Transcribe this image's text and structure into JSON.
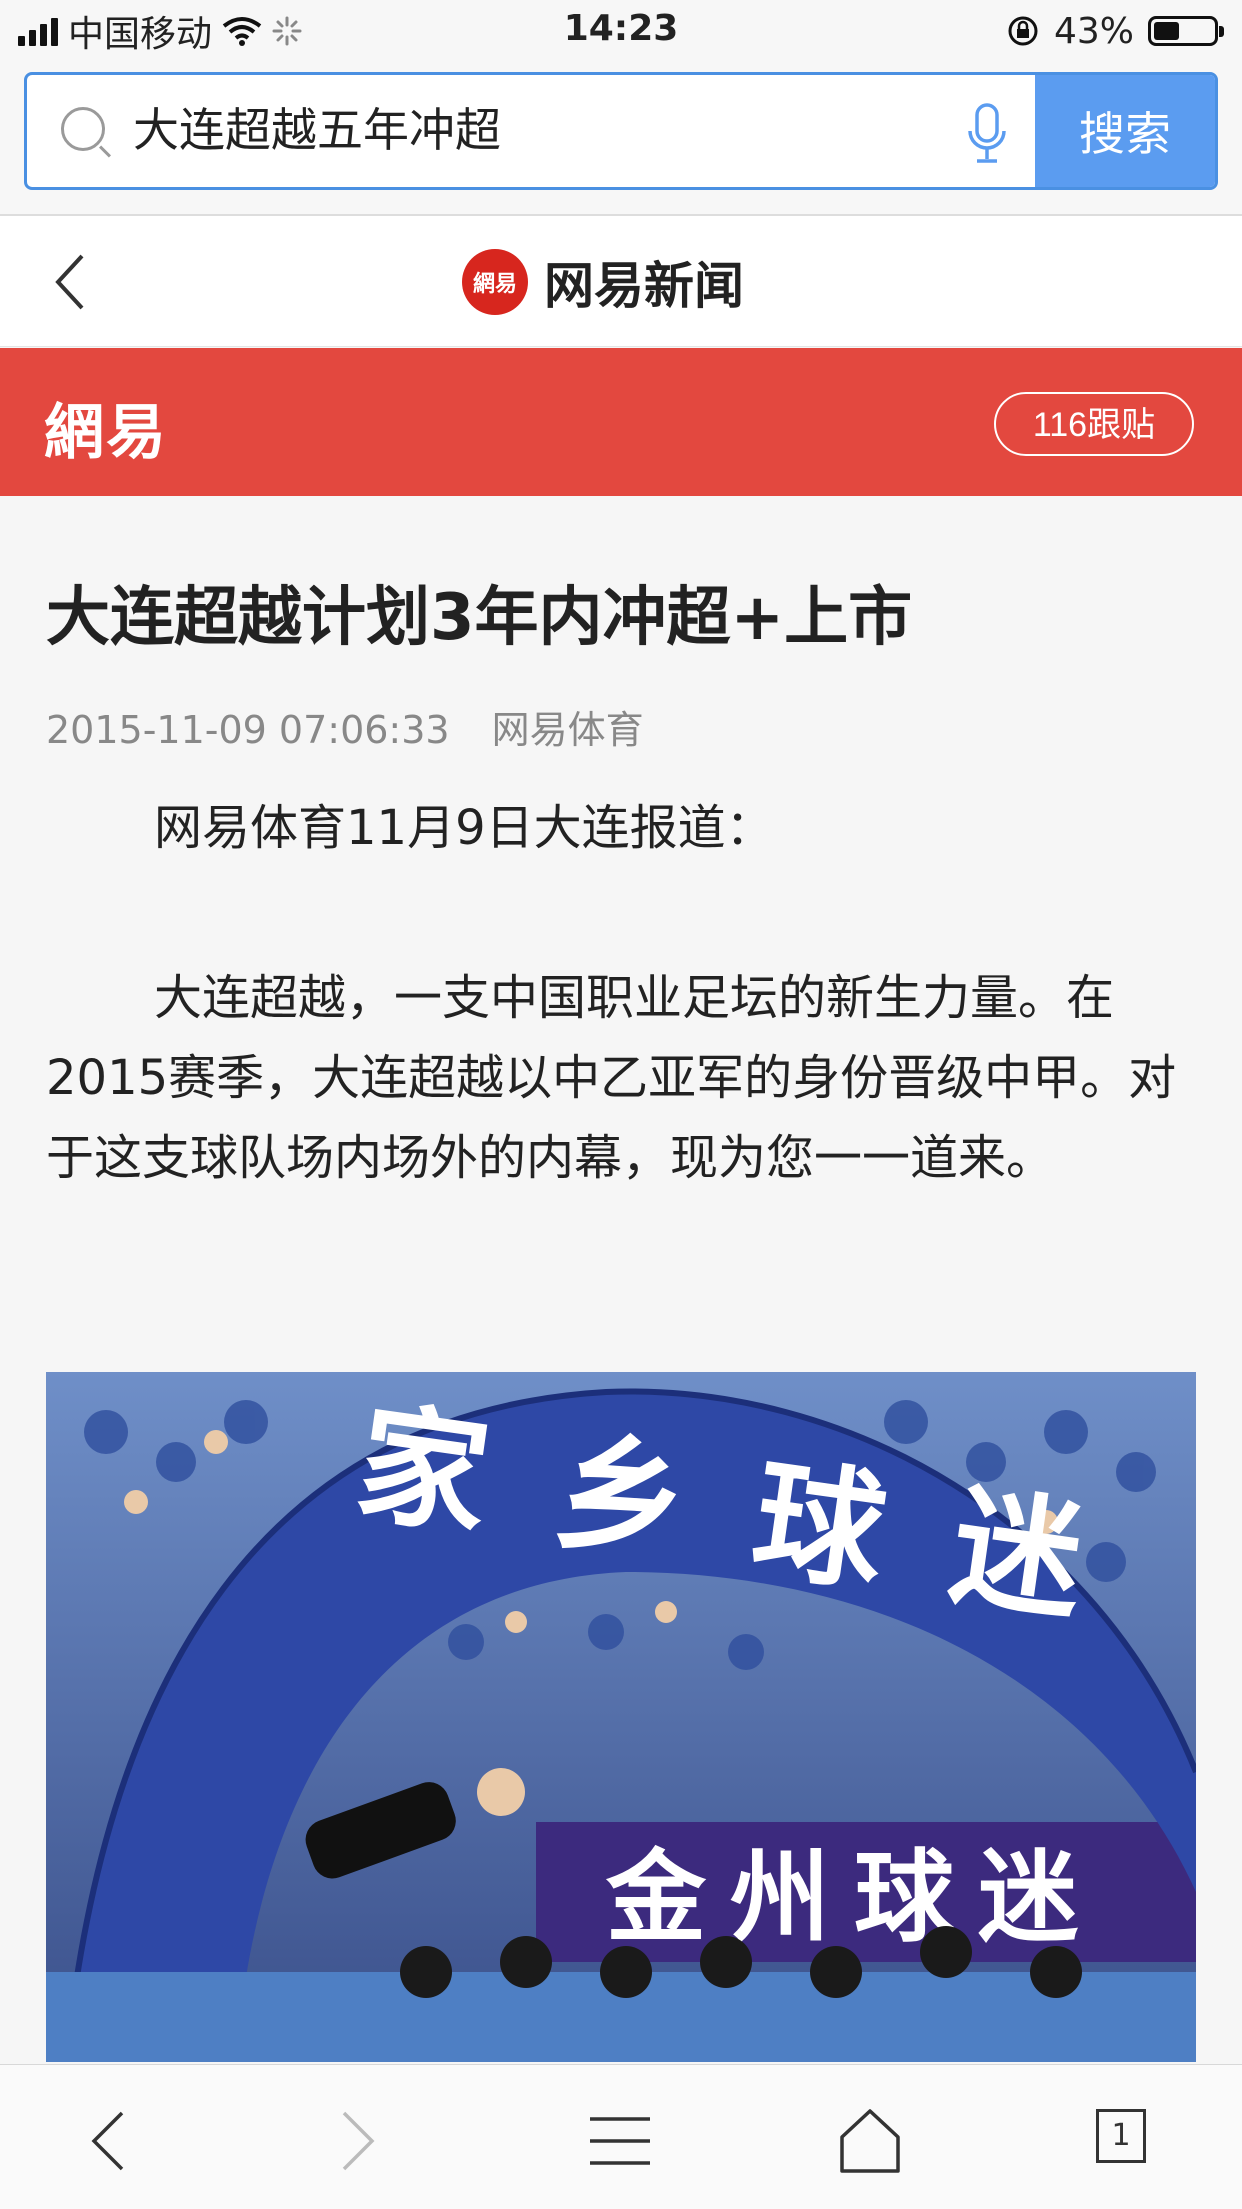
{
  "status_bar": {
    "carrier": "中国移动",
    "time": "14:23",
    "battery_percent": "43%",
    "battery_level": 0.43
  },
  "search": {
    "query": "大连超越五年冲超",
    "button_label": "搜索"
  },
  "nav": {
    "logo_text": "網易",
    "title": "网易新闻"
  },
  "banner": {
    "logo_text": "網易",
    "reply_label": "116跟贴"
  },
  "article": {
    "title": "大连超越计划3年内冲超+上市",
    "date": "2015-11-09 07:06:33",
    "source": "网易体育",
    "paragraph1": "网易体育11月9日大连报道：",
    "paragraph2": "大连超越，一支中国职业足坛的新生力量。在2015赛季，大连超越以中乙亚军的身份晋级中甲。对于这支球队场内场外的内幕，现为您一一道来。",
    "photo_banner_text": "家乡球迷",
    "photo_sign_text": "金州球迷"
  },
  "toolbar": {
    "tabs_count": "1"
  },
  "colors": {
    "accent_blue": "#5b9cf0",
    "netease_red": "#e3483f"
  }
}
